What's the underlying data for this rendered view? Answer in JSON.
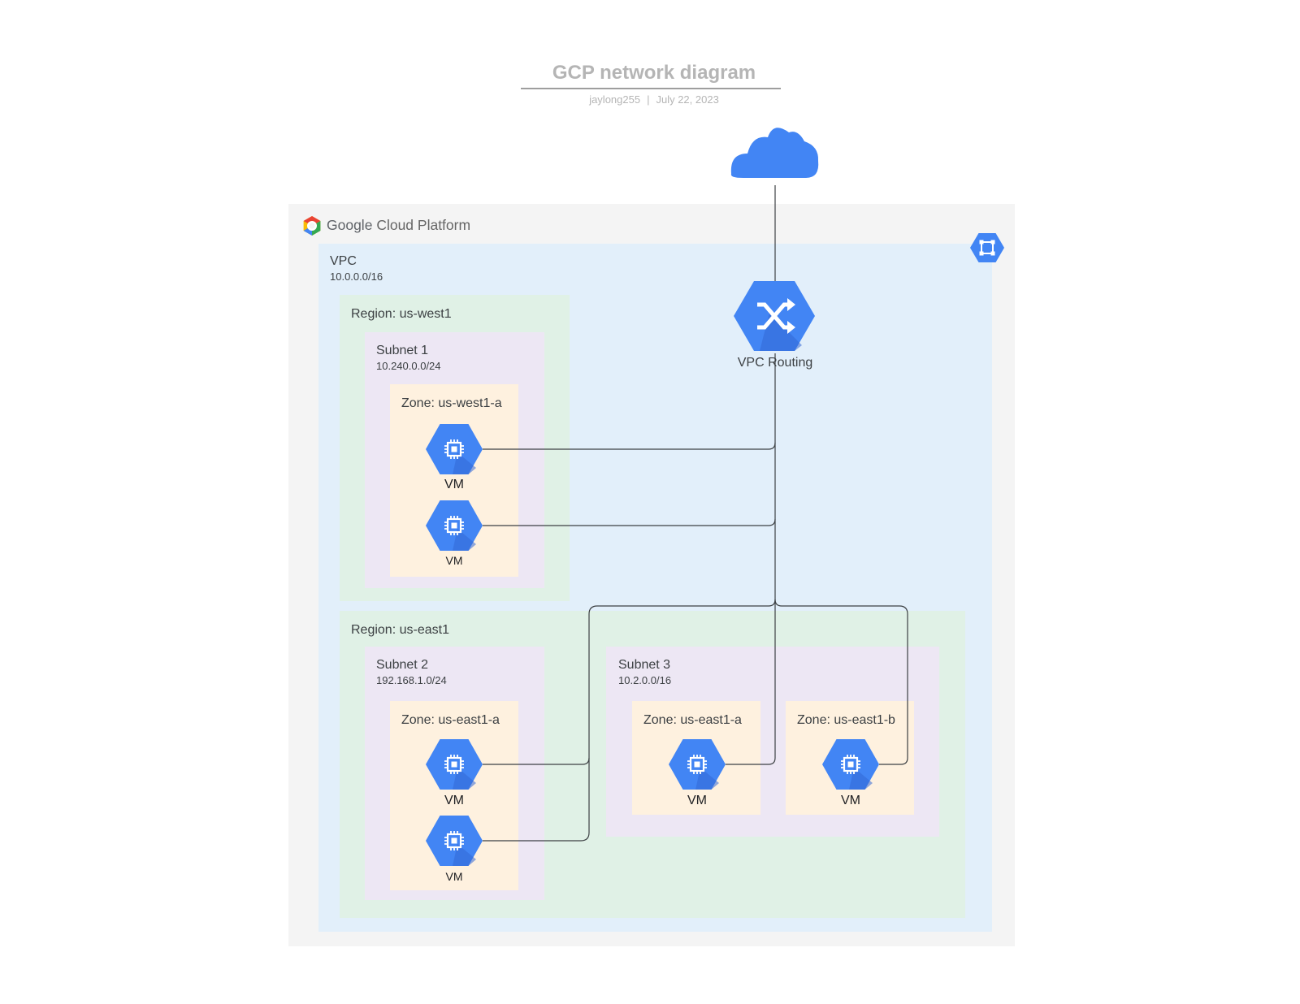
{
  "header": {
    "title": "GCP network diagram",
    "author": "jaylong255",
    "separator": "|",
    "date": "July 22, 2023"
  },
  "platform": {
    "brand_google": "Google",
    "brand_rest": "Cloud Platform"
  },
  "vpc": {
    "label": "VPC",
    "cidr": "10.0.0.0/16",
    "icon": "network-topology-icon"
  },
  "routing": {
    "label": "VPC Routing",
    "icon": "shuffle-routing-icon"
  },
  "internet": {
    "icon": "cloud-icon"
  },
  "regions": [
    {
      "label": "Region: us-west1",
      "subnets": [
        {
          "name": "Subnet 1",
          "cidr": "10.240.0.0/24",
          "zones": [
            {
              "label": "Zone: us-west1-a",
              "vms": [
                "VM",
                "VM"
              ]
            }
          ]
        }
      ]
    },
    {
      "label": "Region: us-east1",
      "subnets": [
        {
          "name": "Subnet 2",
          "cidr": "192.168.1.0/24",
          "zones": [
            {
              "label": "Zone: us-east1-a",
              "vms": [
                "VM",
                "VM"
              ]
            }
          ]
        },
        {
          "name": "Subnet 3",
          "cidr": "10.2.0.0/16",
          "zones": [
            {
              "label": "Zone: us-east1-a",
              "vms": [
                "VM"
              ]
            },
            {
              "label": "Zone: us-east1-b",
              "vms": [
                "VM"
              ]
            }
          ]
        }
      ]
    }
  ],
  "colors": {
    "gcp_blue": "#4285f4",
    "icon_shadow": "#3367d6",
    "vpc_fill": "#e2effa",
    "region_fill": "#e0f1e6",
    "subnet_fill": "#ede7f4",
    "zone_fill": "#fef1df",
    "platform_fill": "#f4f4f4",
    "connector": "#3c4043"
  }
}
